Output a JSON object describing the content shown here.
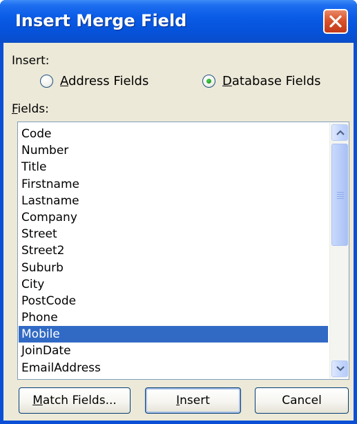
{
  "dialog": {
    "title": "Insert Merge Field",
    "close_icon": "close-x-icon"
  },
  "insert_group": {
    "label": "Insert:",
    "options": [
      {
        "label_prefix": "",
        "label_mnemonic": "A",
        "label_rest": "ddress Fields",
        "selected": false
      },
      {
        "label_prefix": "",
        "label_mnemonic": "D",
        "label_rest": "atabase Fields",
        "selected": true
      }
    ]
  },
  "fields": {
    "label_mnemonic": "F",
    "label_rest": "ields:",
    "items": [
      "Code",
      "Number",
      "Title",
      "Firstname",
      "Lastname",
      "Company",
      "Street",
      "Street2",
      "Suburb",
      "City",
      "PostCode",
      "Phone",
      "Mobile",
      "JoinDate",
      "EmailAddress"
    ],
    "selected": "Mobile",
    "scroll_up_icon": "chevron-up-icon",
    "scroll_down_icon": "chevron-down-icon"
  },
  "buttons": {
    "match_fields": {
      "mnemonic": "M",
      "rest": "atch Fields..."
    },
    "insert": {
      "mnemonic": "I",
      "rest": "nsert"
    },
    "cancel": {
      "label": "Cancel"
    }
  },
  "colors": {
    "titlebar": "#0a5be6",
    "selection": "#316ac5",
    "dialog_bg": "#ece9d8",
    "close_button": "#d9532c"
  }
}
